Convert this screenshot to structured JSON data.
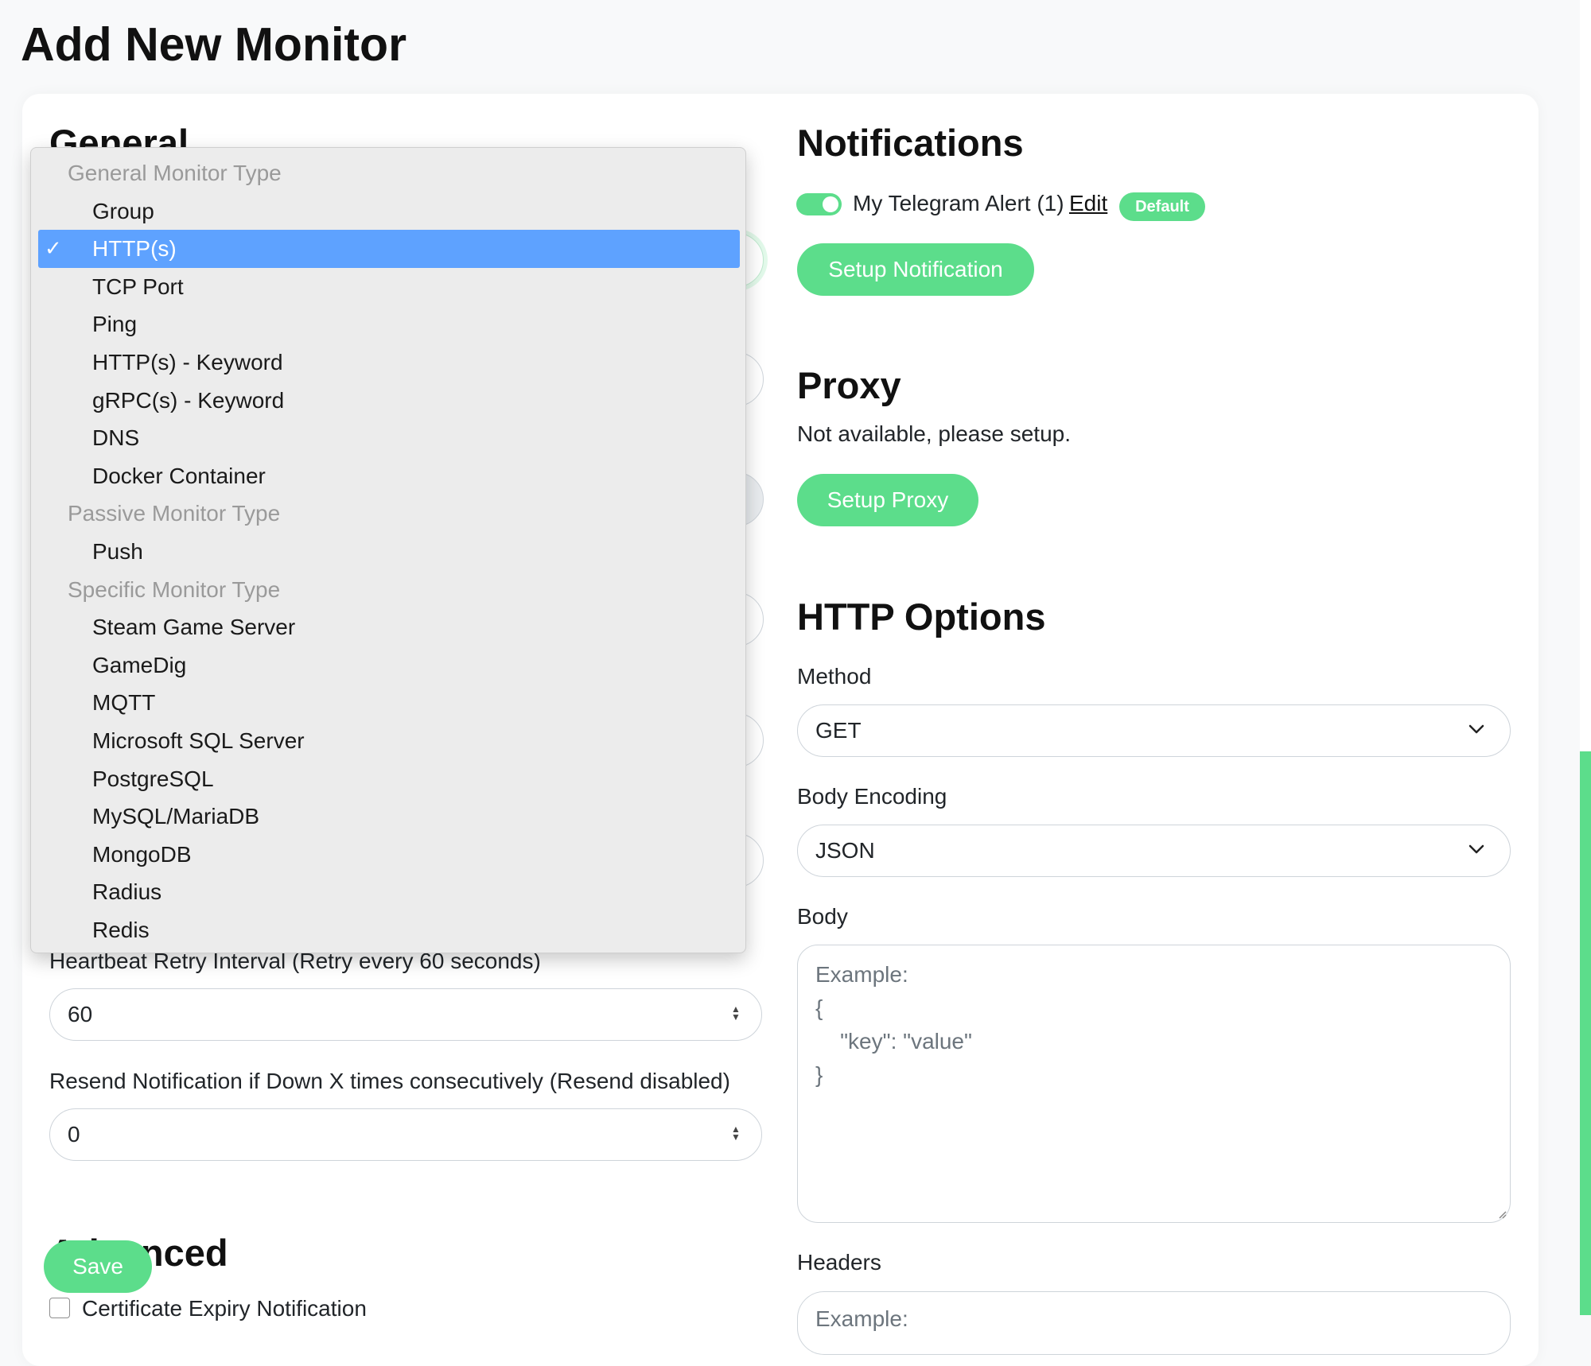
{
  "page": {
    "title": "Add New Monitor"
  },
  "general": {
    "title": "General",
    "retry_interval_label": "Heartbeat Retry Interval (Retry every 60 seconds)",
    "retry_interval_value": "60",
    "resend_label": "Resend Notification if Down X times consecutively (Resend disabled)",
    "resend_value": "0"
  },
  "advanced": {
    "title": "Advanced",
    "cert_expiry_label": "Certificate Expiry Notification"
  },
  "save_button": "Save",
  "notifications": {
    "title": "Notifications",
    "item_label": "My Telegram Alert (1)",
    "edit_link": "Edit",
    "default_badge": "Default",
    "enabled": true,
    "setup_button": "Setup Notification"
  },
  "proxy": {
    "title": "Proxy",
    "message": "Not available, please setup.",
    "setup_button": "Setup Proxy"
  },
  "http_options": {
    "title": "HTTP Options",
    "method_label": "Method",
    "method_value": "GET",
    "encoding_label": "Body Encoding",
    "encoding_value": "JSON",
    "body_label": "Body",
    "body_placeholder_lines": [
      "Example:",
      "{",
      "    \"key\": \"value\"",
      "}"
    ],
    "headers_label": "Headers",
    "headers_placeholder": "Example:"
  },
  "monitor_type_dropdown": {
    "selected": "HTTP(s)",
    "rows": [
      {
        "kind": "group",
        "label": "General Monitor Type"
      },
      {
        "kind": "item",
        "label": "Group"
      },
      {
        "kind": "item",
        "label": "HTTP(s)"
      },
      {
        "kind": "item",
        "label": "TCP Port"
      },
      {
        "kind": "item",
        "label": "Ping"
      },
      {
        "kind": "item",
        "label": "HTTP(s) - Keyword"
      },
      {
        "kind": "item",
        "label": "gRPC(s) - Keyword"
      },
      {
        "kind": "item",
        "label": "DNS"
      },
      {
        "kind": "item",
        "label": "Docker Container"
      },
      {
        "kind": "group",
        "label": "Passive Monitor Type"
      },
      {
        "kind": "item",
        "label": "Push"
      },
      {
        "kind": "group",
        "label": "Specific Monitor Type"
      },
      {
        "kind": "item",
        "label": "Steam Game Server"
      },
      {
        "kind": "item",
        "label": "GameDig"
      },
      {
        "kind": "item",
        "label": "MQTT"
      },
      {
        "kind": "item",
        "label": "Microsoft SQL Server"
      },
      {
        "kind": "item",
        "label": "PostgreSQL"
      },
      {
        "kind": "item",
        "label": "MySQL/MariaDB"
      },
      {
        "kind": "item",
        "label": "MongoDB"
      },
      {
        "kind": "item",
        "label": "Radius"
      },
      {
        "kind": "item",
        "label": "Redis"
      }
    ]
  },
  "colors": {
    "accent_green": "#5cdd8b",
    "selection_blue": "#5ea2ff"
  }
}
